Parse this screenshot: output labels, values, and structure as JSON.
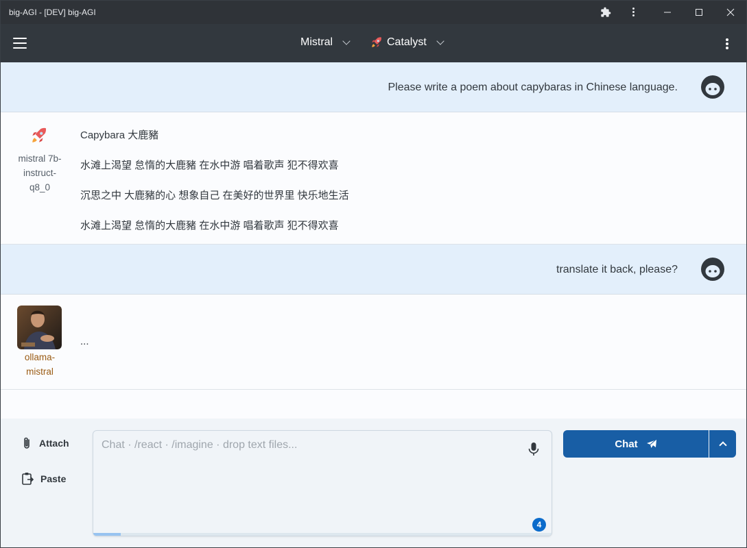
{
  "window": {
    "title": "big-AGI - [DEV] big-AGI",
    "extension_icon": "puzzle-icon",
    "menu_icon": "vertical-dots-icon"
  },
  "header": {
    "model": "Mistral",
    "persona_icon": "rocket-emoji",
    "persona": "Catalyst"
  },
  "messages": [
    {
      "role": "user",
      "text": "Please write a poem about capybaras in Chinese language."
    },
    {
      "role": "assistant",
      "sender": "mistral 7b-instruct-q8_0",
      "sender_lines": [
        "mistral 7b-",
        "instruct-",
        "q8_0"
      ],
      "lines": [
        "Capybara 大鹿豬",
        "水滩上渴望 怠惰的大鹿豬 在水中游 唱着歌声 犯不得欢喜",
        "沉思之中 大鹿豬的心 想象自己 在美好的世界里 快乐地生活",
        "水滩上渴望 怠惰的大鹿豬 在水中游 唱着歌声 犯不得欢喜"
      ]
    },
    {
      "role": "user",
      "text": "translate it back, please?"
    },
    {
      "role": "assistant",
      "sender": "ollama-mistral",
      "sender_lines": [
        "ollama-",
        "mistral"
      ],
      "text": "..."
    }
  ],
  "composer": {
    "attach_label": "Attach",
    "paste_label": "Paste",
    "placeholder": "Chat · /react · /imagine · drop text files...",
    "badge_count": "4",
    "progress_fraction": 0.06,
    "send_label": "Chat"
  },
  "colors": {
    "accent": "#185ea5",
    "user_bubble": "#e3effb",
    "header": "#32383e",
    "sender_accent": "#9a5b13"
  }
}
